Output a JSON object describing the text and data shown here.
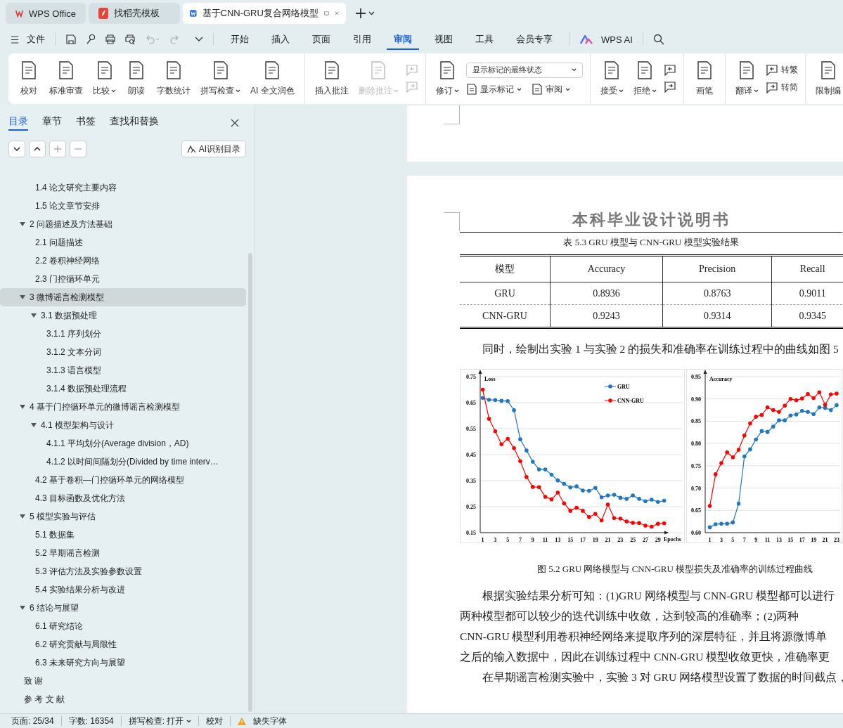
{
  "title_tabs": [
    {
      "label": "WPS Office",
      "kind": "wps",
      "selected": false
    },
    {
      "label": "找稻壳模板",
      "kind": "docer",
      "selected": false
    },
    {
      "label": "基于CNN-GRU复合网络模型",
      "kind": "writer",
      "selected": true
    }
  ],
  "menu": {
    "file": "文件",
    "tabs": [
      {
        "label": "开始",
        "selected": false
      },
      {
        "label": "插入",
        "selected": false
      },
      {
        "label": "页面",
        "selected": false
      },
      {
        "label": "引用",
        "selected": false
      },
      {
        "label": "审阅",
        "selected": true
      },
      {
        "label": "视图",
        "selected": false
      },
      {
        "label": "工具",
        "selected": false
      },
      {
        "label": "会员专享",
        "selected": false
      }
    ],
    "ai": "WPS AI"
  },
  "ribbon": [
    {
      "items": [
        {
          "kind": "large",
          "label": "校对",
          "dropdown": false,
          "disabled": false
        },
        {
          "kind": "large",
          "label": "标准审查",
          "dropdown": false,
          "disabled": false
        },
        {
          "kind": "large",
          "label": "比较",
          "dropdown": true,
          "disabled": false
        },
        {
          "kind": "large",
          "label": "朗读",
          "dropdown": false,
          "disabled": false
        },
        {
          "kind": "large",
          "label": "字数统计",
          "dropdown": false,
          "disabled": false
        },
        {
          "kind": "large",
          "label": "拼写检查",
          "dropdown": true,
          "disabled": false
        },
        {
          "kind": "large",
          "label": "AI 全文润色",
          "dropdown": false,
          "disabled": false
        }
      ]
    },
    {
      "items": [
        {
          "kind": "large",
          "label": "插入批注",
          "dropdown": false,
          "disabled": false
        },
        {
          "kind": "large",
          "label": "删除批注",
          "dropdown": true,
          "disabled": true
        },
        {
          "kind": "stack",
          "buttons": [
            {
              "disabled": true
            },
            {
              "disabled": true
            }
          ]
        }
      ]
    },
    {
      "items": [
        {
          "kind": "large",
          "label": "修订",
          "dropdown": true,
          "disabled": false
        },
        {
          "kind": "review",
          "select": "显示标记的最终状态",
          "buttons": [
            {
              "label": "显示标记",
              "dropdown": true,
              "disabled": false
            },
            {
              "label": "审阅",
              "dropdown": true,
              "disabled": false
            }
          ]
        }
      ]
    },
    {
      "items": [
        {
          "kind": "large",
          "label": "接受",
          "dropdown": true,
          "disabled": false
        },
        {
          "kind": "large",
          "label": "拒绝",
          "dropdown": true,
          "disabled": false
        },
        {
          "kind": "stack",
          "buttons": [
            {
              "disabled": false
            },
            {
              "disabled": false
            }
          ]
        }
      ]
    },
    {
      "items": [
        {
          "kind": "large",
          "label": "画笔",
          "dropdown": false,
          "disabled": false
        }
      ]
    },
    {
      "items": [
        {
          "kind": "large",
          "label": "翻译",
          "dropdown": true,
          "disabled": false
        },
        {
          "kind": "stack",
          "buttons": [
            {
              "label": "转繁",
              "disabled": false
            },
            {
              "label": "转简",
              "disabled": false
            }
          ]
        }
      ]
    },
    {
      "items": [
        {
          "kind": "large",
          "label": "限制编",
          "dropdown": false,
          "disabled": false
        }
      ]
    }
  ],
  "sidebar": {
    "tabs": [
      {
        "label": "目录",
        "selected": true
      },
      {
        "label": "章节",
        "selected": false
      },
      {
        "label": "书签",
        "selected": false
      },
      {
        "label": "查找和替换",
        "selected": false
      }
    ],
    "ai_button": "AI识别目录",
    "scrolled_children": [
      {
        "label": "1.4 论文研究主要内容",
        "selected": false
      },
      {
        "label": "1.5 论文章节安排",
        "selected": false
      }
    ],
    "toc": [
      {
        "label": "2  问题描述及方法基础",
        "selected": false,
        "expanded": true,
        "children": [
          {
            "label": "2.1    问题描述",
            "selected": false
          },
          {
            "label": "2.2    卷积神经网络",
            "selected": false
          },
          {
            "label": "2.3    门控循环单元",
            "selected": false
          }
        ]
      },
      {
        "label": "3    微博谣言检测模型",
        "selected": true,
        "expanded": true,
        "children": [
          {
            "label": "3.1    数据预处理",
            "selected": false,
            "expanded": true,
            "children": [
              {
                "label": "3.1.1    序列划分",
                "selected": false
              },
              {
                "label": "3.1.2    文本分词",
                "selected": false
              },
              {
                "label": "3.1.3    语言模型",
                "selected": false
              },
              {
                "label": "3.1.4    数据预处理流程",
                "selected": false
              }
            ]
          }
        ]
      },
      {
        "label": "4  基于门控循环单元的微博谣言检测模型",
        "selected": false,
        "expanded": true,
        "children": [
          {
            "label": "4.1  模型架构与设计",
            "selected": false,
            "expanded": true,
            "children": [
              {
                "label": "4.1.1    平均划分(Average division，AD)",
                "selected": false
              },
              {
                "label": "4.1.2    以时间间隔划分(Divided by time interv…",
                "selected": false
              }
            ]
          },
          {
            "label": "4.2    基于卷积—门控循环单元的网络模型",
            "selected": false
          },
          {
            "label": "4.3 目标函数及优化方法",
            "selected": false
          }
        ]
      },
      {
        "label": "5  模型实验与评估",
        "selected": false,
        "expanded": true,
        "children": [
          {
            "label": "5.1    数据集",
            "selected": false
          },
          {
            "label": "5.2    早期谣言检测",
            "selected": false
          },
          {
            "label": "5.3    评估方法及实验参数设置",
            "selected": false
          },
          {
            "label": "5.4    实验结果分析与改进",
            "selected": false
          }
        ]
      },
      {
        "label": "6  结论与展望",
        "selected": false,
        "expanded": true,
        "children": [
          {
            "label": "6.1  研究结论",
            "selected": false
          },
          {
            "label": "6.2  研究贡献与局限性",
            "selected": false
          },
          {
            "label": "6.3  未来研究方向与展望",
            "selected": false
          }
        ]
      },
      {
        "label": "致   谢",
        "selected": false
      },
      {
        "label": "参 考 文 献",
        "selected": false
      }
    ]
  },
  "document": {
    "header": "本科毕业设计说明书",
    "table_caption": "表 5.3 GRU 模型与 CNN-GRU 模型实验结果",
    "table": {
      "columns": [
        "模型",
        "Accuracy",
        "Precision",
        "Recall"
      ],
      "rows": [
        [
          "GRU",
          "0.8936",
          "0.8763",
          "0.9011"
        ],
        [
          "CNN-GRU",
          "0.9243",
          "0.9314",
          "0.9345"
        ]
      ]
    },
    "intro": "同时，绘制出实验 1 与实验 2 的损失和准确率在训练过程中的曲线如图 5",
    "charts": [
      {
        "chart_data": {
          "type": "line",
          "title": "Loss",
          "xlabel": "Epochs",
          "x": [
            1,
            2,
            3,
            4,
            5,
            6,
            7,
            8,
            9,
            10,
            11,
            12,
            13,
            14,
            15,
            16,
            17,
            18,
            19,
            20,
            21,
            22,
            23,
            24,
            25,
            26,
            27,
            28,
            29,
            30
          ],
          "series": [
            {
              "name": "GRU",
              "color": "#1f77c4",
              "values": [
                0.668,
                0.661,
                0.66,
                0.657,
                0.656,
                0.621,
                0.509,
                0.466,
                0.423,
                0.393,
                0.393,
                0.373,
                0.351,
                0.338,
                0.324,
                0.328,
                0.312,
                0.311,
                0.322,
                0.286,
                0.293,
                0.296,
                0.284,
                0.28,
                0.293,
                0.28,
                0.271,
                0.277,
                0.268,
                0.273
              ]
            },
            {
              "name": "CNN-GRU",
              "color": "#ff0000",
              "values": [
                0.7,
                0.588,
                0.54,
                0.49,
                0.511,
                0.475,
                0.425,
                0.364,
                0.326,
                0.325,
                0.288,
                0.278,
                0.304,
                0.263,
                0.234,
                0.246,
                0.234,
                0.21,
                0.222,
                0.197,
                0.258,
                0.206,
                0.204,
                0.193,
                0.188,
                0.187,
                0.177,
                0.173,
                0.184,
                0.186
              ]
            }
          ],
          "xlim": [
            0.6,
            30.6
          ],
          "ylim": [
            0.15,
            0.75
          ],
          "yticks": [
            0.15,
            0.25,
            0.35,
            0.45,
            0.55,
            0.65,
            0.75
          ],
          "xticks": [
            1,
            3,
            5,
            7,
            9,
            11,
            13,
            15,
            17,
            19,
            21,
            23,
            25,
            27,
            29
          ],
          "grid": true,
          "legend": true
        }
      },
      {
        "chart_data": {
          "type": "line",
          "title": "Accuracy",
          "x": [
            1,
            2,
            3,
            4,
            5,
            6,
            7,
            8,
            9,
            10,
            11,
            12,
            13,
            14,
            15,
            16,
            17,
            18,
            19,
            20,
            21,
            22,
            23
          ],
          "series": [
            {
              "color": "#1f77c4",
              "values": [
                0.612,
                0.619,
                0.62,
                0.62,
                0.623,
                0.665,
                0.771,
                0.787,
                0.809,
                0.828,
                0.826,
                0.838,
                0.852,
                0.852,
                0.863,
                0.865,
                0.873,
                0.871,
                0.866,
                0.881,
                0.88,
                0.875,
                0.886
              ]
            },
            {
              "color": "#ff0000",
              "values": [
                0.66,
                0.731,
                0.756,
                0.78,
                0.769,
                0.786,
                0.818,
                0.845,
                0.86,
                0.864,
                0.881,
                0.875,
                0.871,
                0.885,
                0.9,
                0.897,
                0.901,
                0.911,
                0.902,
                0.915,
                0.887,
                0.91,
                0.912
              ]
            }
          ],
          "xlim": [
            0.2,
            23.6
          ],
          "ylim": [
            0.6,
            0.95
          ],
          "yticks": [
            {
              "value": 0.6,
              "label": "0.60"
            },
            0.65,
            {
              "value": 0.7,
              "label": "0.70"
            },
            0.75,
            {
              "value": 0.8,
              "label": "0.80"
            },
            0.85,
            {
              "value": 0.9,
              "label": "0.90"
            },
            0.95
          ],
          "xticks": [
            1,
            3,
            5,
            7,
            9,
            11,
            13,
            15,
            17,
            19,
            21,
            23
          ],
          "grid": true
        }
      }
    ],
    "figure_caption": "图 5.2 GRU 网络模型与 CNN-GRU 模型损失及准确率的训练过程曲线",
    "paragraphs": [
      {
        "lines": [
          "根据实验结果分析可知：(1)GRU 网络模型与 CNN-GRU 模型都可以进行",
          "两种模型都可以较少的迭代训练中收敛，达到较高的准确率；(2)两种",
          "CNN-GRU 模型利用卷积神经网络来提取序列的深层特征，并且将源微博单",
          "之后的输入数据中，因此在训练过程中 CNN-GRU 模型收敛更快，准确率更"
        ]
      },
      {
        "lines": [
          "在早期谣言检测实验中，实验 3 对 GRU 网络模型设置了数据的时间截点，"
        ]
      }
    ]
  },
  "status_bar": {
    "page": "页面: 25/34",
    "words": "字数: 16354",
    "spell": "拼写检查: 打开",
    "proof": "校对",
    "font": "缺失字体"
  }
}
